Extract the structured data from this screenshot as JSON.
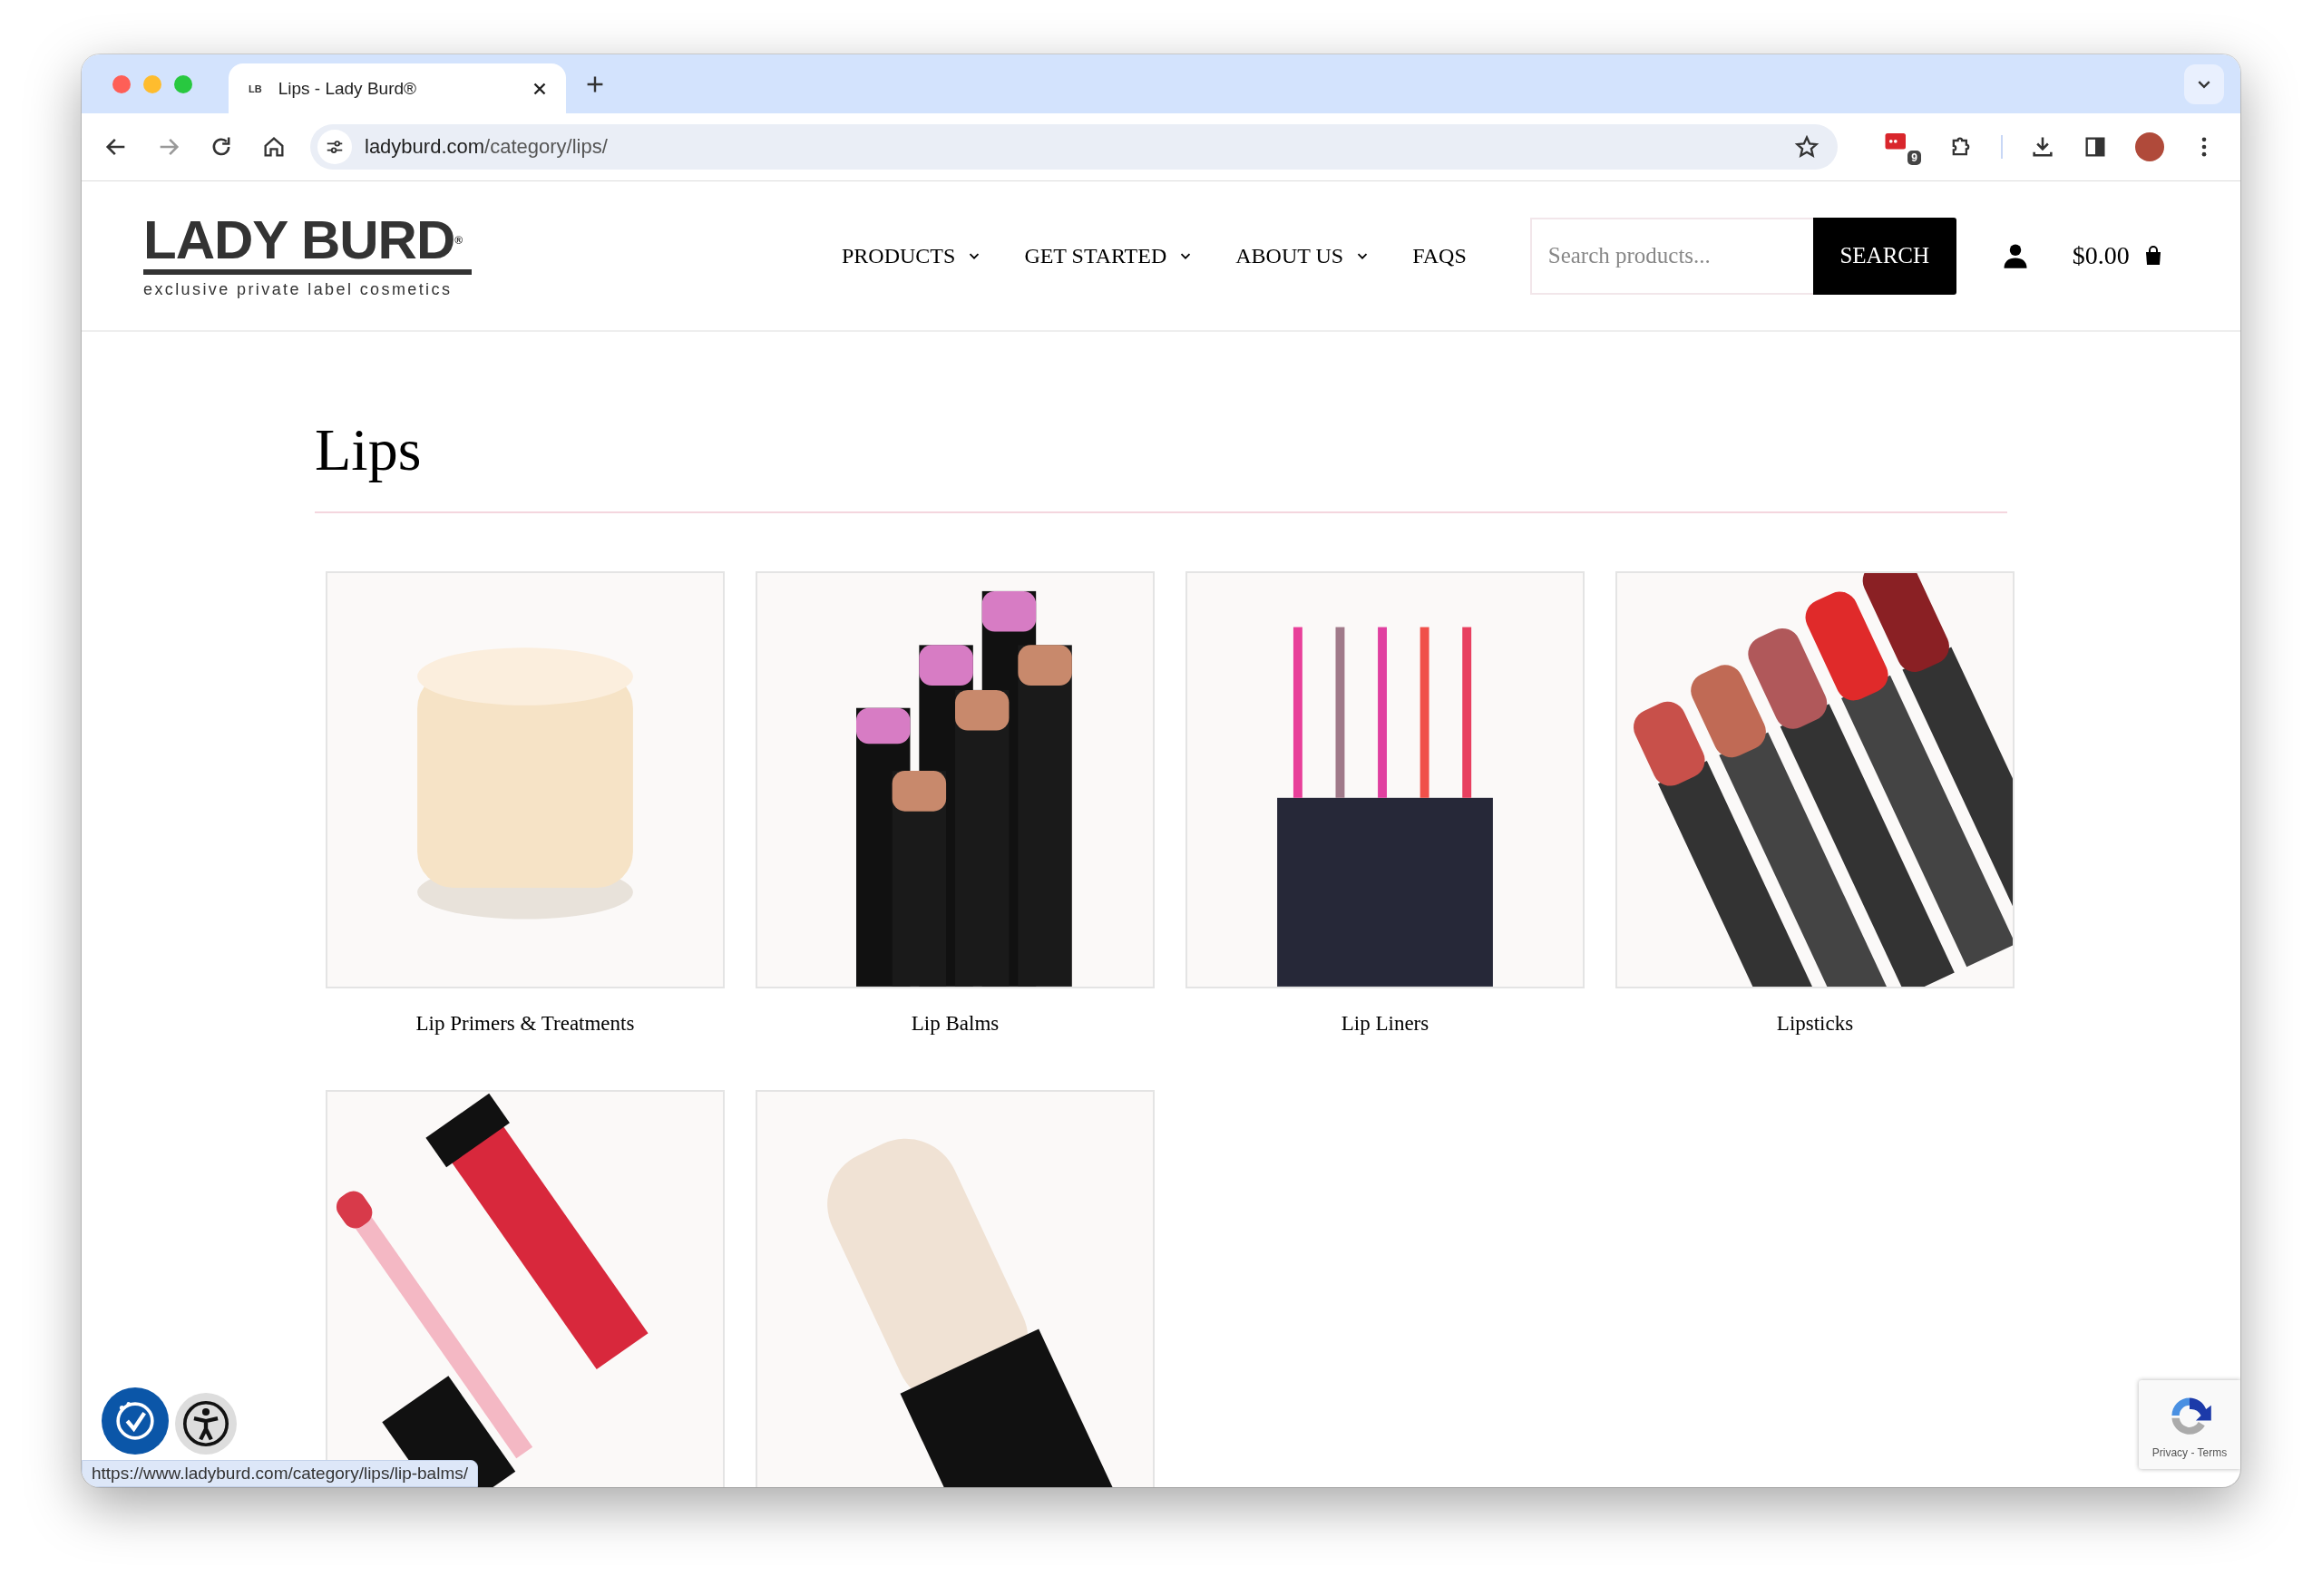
{
  "browser": {
    "tab": {
      "title": "Lips - Lady Burd®",
      "favicon": "LB"
    },
    "url": {
      "host": "ladyburd.com",
      "path": "/category/lips/"
    },
    "extension_badge": "9",
    "status_url": "https://www.ladyburd.com/category/lips/lip-balms/"
  },
  "header": {
    "logo": {
      "name": "LADY BURD",
      "mark": "®",
      "tagline": "exclusive private label cosmetics"
    },
    "nav": [
      {
        "label": "PRODUCTS",
        "has_menu": true
      },
      {
        "label": "GET STARTED",
        "has_menu": true
      },
      {
        "label": "ABOUT US",
        "has_menu": true
      },
      {
        "label": "FAQS",
        "has_menu": false
      }
    ],
    "search": {
      "placeholder": "Search products...",
      "button": "SEARCH"
    },
    "cart_total": "$0.00"
  },
  "page_title": "Lips",
  "categories": [
    {
      "name": "Lip Primers & Treatments",
      "kind": "jar"
    },
    {
      "name": "Lip Balms",
      "kind": "balms"
    },
    {
      "name": "Lip Liners",
      "kind": "liners"
    },
    {
      "name": "Lipsticks",
      "kind": "lipsticks"
    },
    {
      "kind": "gloss"
    },
    {
      "kind": "stick"
    }
  ],
  "recaptcha": {
    "links": "Privacy - Terms"
  }
}
